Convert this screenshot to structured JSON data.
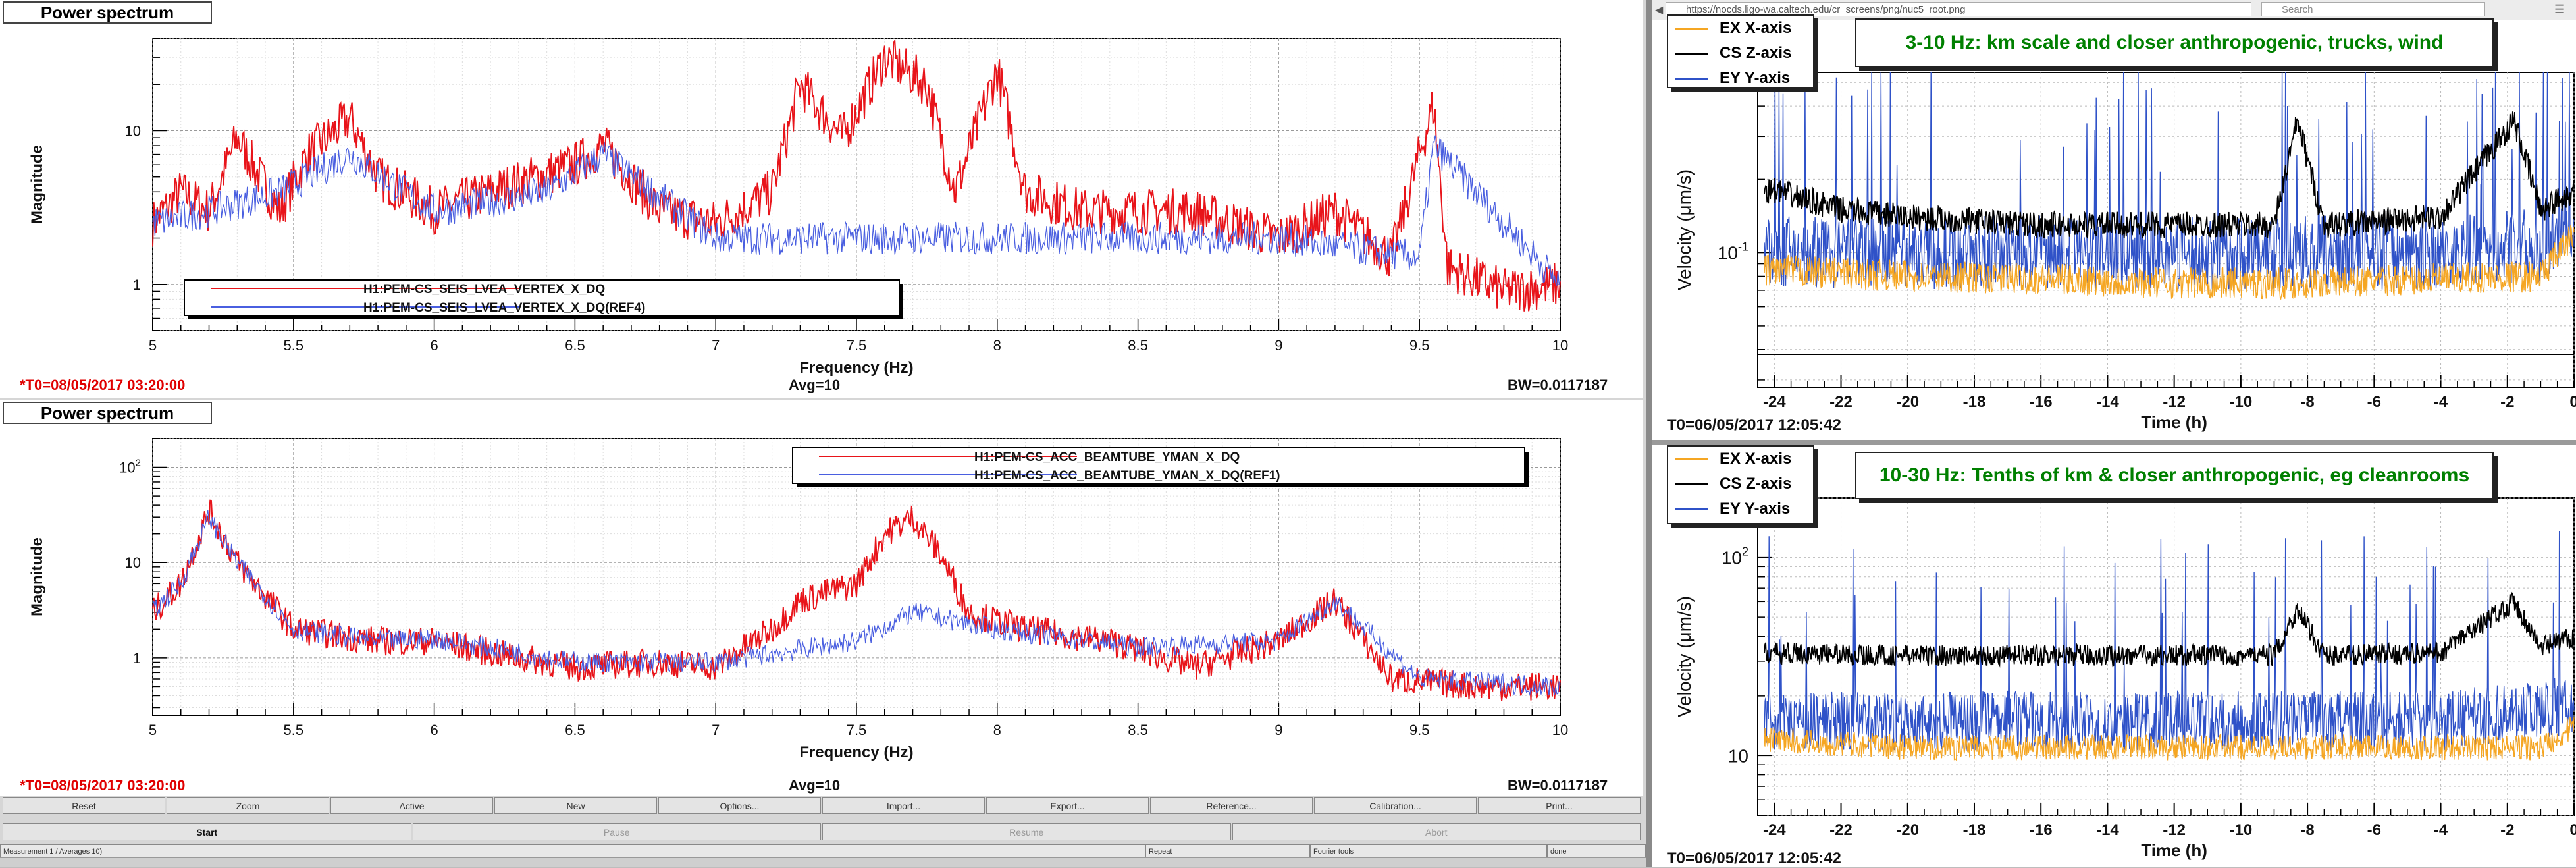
{
  "left": {
    "panels": [
      {
        "header": "Power spectrum",
        "ylabel": "Magnitude",
        "xlabel": "Frequency (Hz)",
        "t0": "*T0=08/05/2017 03:20:00",
        "avg": "Avg=10",
        "bw": "BW=0.0117187",
        "legend": [
          "H1:PEM-CS_SEIS_LVEA_VERTEX_X_DQ",
          "H1:PEM-CS_SEIS_LVEA_VERTEX_X_DQ(REF4)"
        ],
        "yticks": [
          "1",
          "10"
        ]
      },
      {
        "header": "Power spectrum",
        "ylabel": "Magnitude",
        "xlabel": "Frequency (Hz)",
        "t0": "*T0=08/05/2017 03:20:00",
        "avg": "Avg=10",
        "bw": "BW=0.0117187",
        "legend": [
          "H1:PEM-CS_ACC_BEAMTUBE_YMAN_X_DQ",
          "H1:PEM-CS_ACC_BEAMTUBE_YMAN_X_DQ(REF1)"
        ],
        "yticks": [
          "1",
          "10",
          "10",
          "2"
        ]
      }
    ],
    "xticks": [
      "5",
      "5.5",
      "6",
      "6.5",
      "7",
      "7.5",
      "8",
      "8.5",
      "9",
      "9.5",
      "10"
    ],
    "buttons": [
      "Reset",
      "Zoom",
      "Active",
      "New",
      "Options...",
      "Import...",
      "Export...",
      "Reference...",
      "Calibration...",
      "Print..."
    ],
    "controls": [
      "Start",
      "Pause",
      "Resume",
      "Abort"
    ],
    "status": [
      "Measurement 1 / Averages 10)",
      "Repeat",
      "Fourier tools",
      "done"
    ]
  },
  "browser": {
    "url": "https://nocds.ligo-wa.caltech.edu/cr_screens/png/nuc5_root.png",
    "search": "Search"
  },
  "right": {
    "panels": [
      {
        "title": "3-10 Hz: km scale and closer anthropogenic, trucks, wind",
        "ylabel": "Velocity   (μm/s)",
        "xlabel": "Time (h)",
        "t0": "T0=06/05/2017 12:05:42",
        "ytick": "10",
        "ytick_exp": "-1",
        "legend": [
          "EX X-axis",
          "CS Z-axis",
          "EY Y-axis"
        ]
      },
      {
        "title": "10-30 Hz: Tenths of km & closer anthropogenic, eg cleanrooms",
        "ylabel": "Velocity   (μm/s)",
        "xlabel": "Time (h)",
        "t0": "T0=06/05/2017 12:05:42",
        "yticks": [
          "10",
          "10"
        ],
        "ytick_exp": "2",
        "legend": [
          "EX X-axis",
          "CS Z-axis",
          "EY Y-axis"
        ]
      }
    ],
    "xticks": [
      "-24",
      "-22",
      "-20",
      "-18",
      "-16",
      "-14",
      "-12",
      "-10",
      "-8",
      "-6",
      "-4",
      "-2",
      "0"
    ]
  },
  "colors": {
    "red": "#e8141a",
    "blue": "#4a5fe0",
    "orange": "#f5a623",
    "black": "#000000",
    "trendblue": "#2f52c8",
    "green": "#008000"
  },
  "chart_data": [
    {
      "type": "line",
      "title": "Power spectrum",
      "xlabel": "Frequency (Hz)",
      "ylabel": "Magnitude",
      "yscale": "log",
      "xlim": [
        5,
        10
      ],
      "ylim": [
        0.5,
        40
      ],
      "series": [
        {
          "name": "H1:PEM-CS_SEIS_LVEA_VERTEX_X_DQ",
          "x": [
            5,
            5.1,
            5.2,
            5.3,
            5.45,
            5.55,
            5.7,
            5.8,
            6,
            6.2,
            6.5,
            6.6,
            6.8,
            7,
            7.2,
            7.3,
            7.45,
            7.6,
            7.75,
            7.85,
            8,
            8.1,
            8.3,
            8.5,
            8.7,
            9,
            9.2,
            9.4,
            9.55,
            9.6,
            9.8,
            10
          ],
          "y": [
            2.5,
            4,
            3,
            9,
            3,
            7,
            12,
            5,
            3,
            4,
            6,
            8,
            3,
            2.5,
            4,
            20,
            9,
            30,
            20,
            4,
            25,
            4,
            3,
            3,
            3,
            2,
            3,
            1.5,
            15,
            1.3,
            0.9,
            1
          ]
        },
        {
          "name": "H1:PEM-CS_SEIS_LVEA_VERTEX_X_DQ(REF4)",
          "x": [
            5,
            5.2,
            5.45,
            5.7,
            6,
            6.4,
            6.6,
            7,
            7.5,
            8,
            8.5,
            9,
            9.5,
            9.55,
            10
          ],
          "y": [
            2.5,
            3,
            4,
            7,
            3,
            4,
            7,
            2,
            2,
            2,
            2,
            2,
            1.5,
            8,
            1
          ]
        }
      ]
    },
    {
      "type": "line",
      "title": "Power spectrum",
      "xlabel": "Frequency (Hz)",
      "ylabel": "Magnitude",
      "yscale": "log",
      "xlim": [
        5,
        10
      ],
      "ylim": [
        0.25,
        200
      ],
      "series": [
        {
          "name": "H1:PEM-CS_ACC_BEAMTUBE_YMAN_X_DQ",
          "x": [
            5,
            5.1,
            5.2,
            5.3,
            5.5,
            5.8,
            6,
            6.3,
            6.5,
            6.8,
            7,
            7.2,
            7.3,
            7.5,
            7.6,
            7.7,
            7.8,
            7.9,
            8.1,
            8.4,
            8.7,
            9,
            9.2,
            9.4,
            9.7,
            10
          ],
          "y": [
            3,
            6,
            35,
            10,
            2,
            1.5,
            1.5,
            1,
            0.8,
            0.9,
            0.8,
            2,
            4,
            6,
            20,
            30,
            12,
            3,
            2,
            1.5,
            0.8,
            1.5,
            4,
            0.6,
            0.5,
            0.5
          ]
        },
        {
          "name": "H1:PEM-CS_ACC_BEAMTUBE_YMAN_X_DQ(REF1)",
          "x": [
            5,
            5.1,
            5.2,
            5.3,
            5.5,
            5.8,
            6,
            6.5,
            7,
            7.5,
            7.7,
            8,
            8.5,
            9,
            9.2,
            9.5,
            10
          ],
          "y": [
            3,
            6,
            30,
            10,
            2,
            1.5,
            1.6,
            0.9,
            0.9,
            1.5,
            3,
            2,
            1.3,
            1.5,
            4,
            0.6,
            0.5
          ]
        }
      ]
    },
    {
      "type": "line",
      "title": "3-10 Hz: km scale and closer anthropogenic, trucks, wind",
      "xlabel": "Time (h)",
      "ylabel": "Velocity (μm/s)",
      "yscale": "log",
      "xlim": [
        -24.5,
        0
      ],
      "series": [
        {
          "name": "EX X-axis",
          "x": [
            -24,
            -20,
            -16,
            -12,
            -8,
            -4,
            -1,
            0
          ],
          "y": [
            0.085,
            0.08,
            0.078,
            0.075,
            0.075,
            0.078,
            0.08,
            0.12
          ]
        },
        {
          "name": "CS Z-axis",
          "x": [
            -24,
            -22,
            -20,
            -16,
            -12,
            -9,
            -8.3,
            -7.5,
            -4,
            -1.8,
            -1,
            0
          ],
          "y": [
            0.18,
            0.15,
            0.14,
            0.13,
            0.13,
            0.13,
            0.35,
            0.13,
            0.14,
            0.35,
            0.15,
            0.18
          ]
        },
        {
          "name": "EY Y-axis",
          "x": [
            -24,
            -20,
            -16,
            -12,
            -8,
            -4,
            0
          ],
          "y": [
            0.1,
            0.1,
            0.1,
            0.1,
            0.1,
            0.1,
            0.11
          ]
        }
      ]
    },
    {
      "type": "line",
      "title": "10-30 Hz: Tenths of km & closer anthropogenic, eg cleanrooms",
      "xlabel": "Time (h)",
      "ylabel": "Velocity (μm/s)",
      "yscale": "log",
      "xlim": [
        -24.5,
        0
      ],
      "series": [
        {
          "name": "EX X-axis",
          "x": [
            -24,
            -20,
            -16,
            -12,
            -8,
            -4,
            -1,
            0
          ],
          "y": [
            12,
            11,
            11,
            11,
            11,
            11,
            11,
            14
          ]
        },
        {
          "name": "CS Z-axis",
          "x": [
            -24,
            -20,
            -16,
            -12,
            -9,
            -8.3,
            -7.5,
            -4,
            -1.8,
            -1,
            0
          ],
          "y": [
            33,
            32,
            32,
            32,
            32,
            55,
            32,
            33,
            60,
            35,
            40
          ]
        },
        {
          "name": "EY Y-axis",
          "x": [
            -24,
            -20,
            -16,
            -12,
            -8,
            -4,
            0
          ],
          "y": [
            15,
            15,
            15,
            15,
            15,
            15,
            18
          ]
        }
      ]
    }
  ]
}
